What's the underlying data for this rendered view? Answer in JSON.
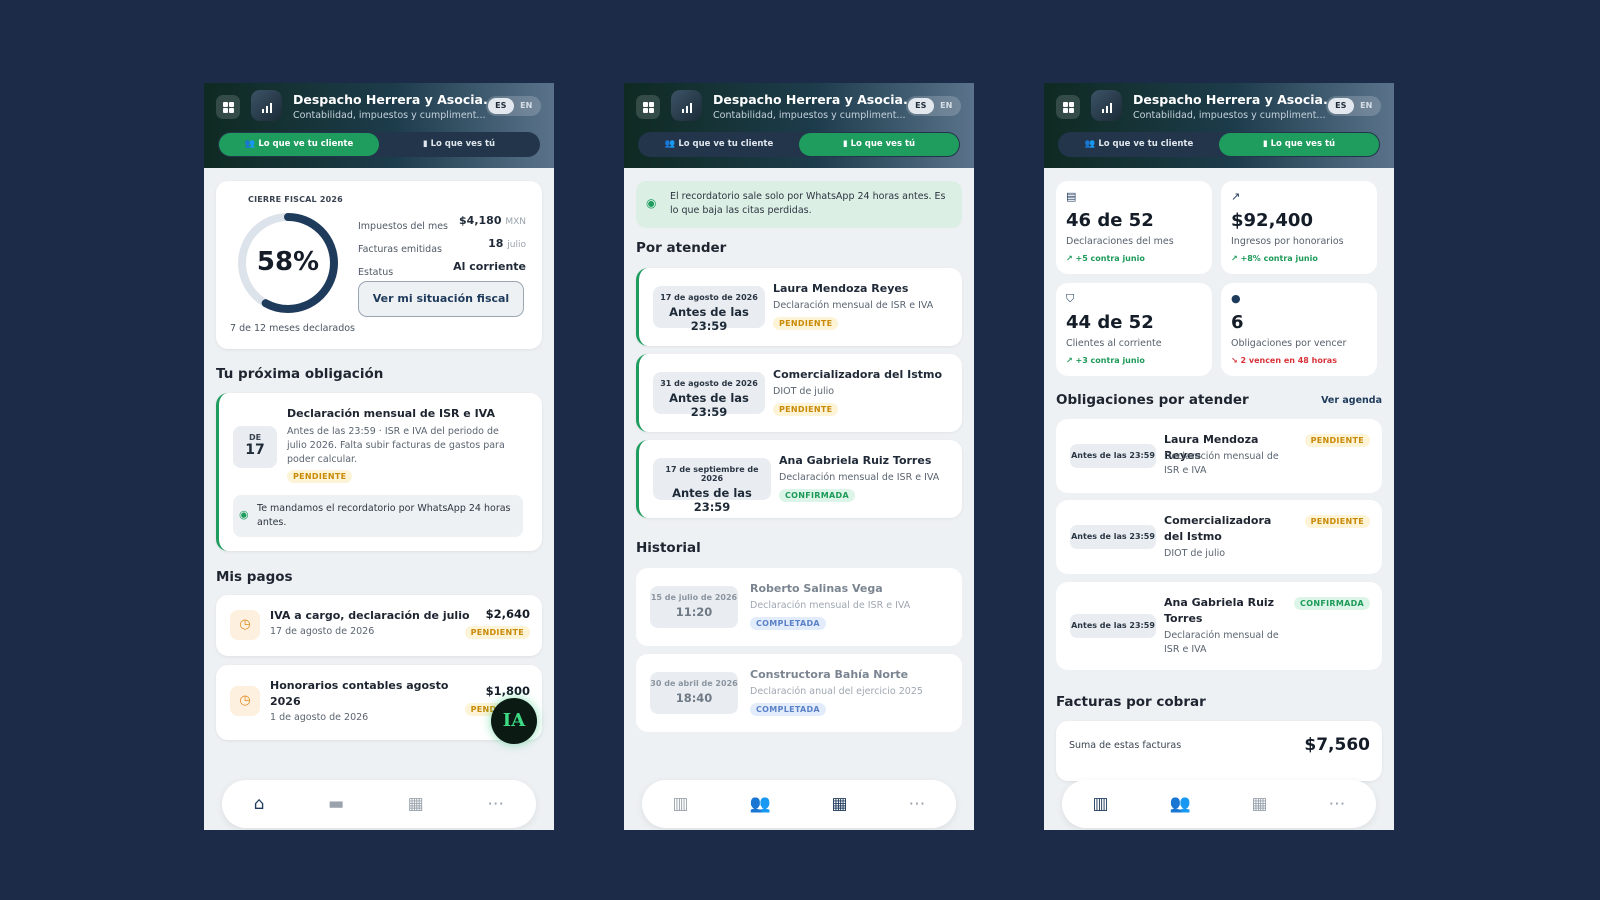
{
  "app": {
    "firm_name": "Despacho Herrera y Asocia...",
    "subtitle": "Contabilidad, impuestos y cumpliment...",
    "lang_es": "ES",
    "lang_en": "EN",
    "tab_client": "Lo que ve tu cliente",
    "tab_you": "Lo que ves tú"
  },
  "screen1": {
    "fiscal_label": "CIERRE FISCAL 2026",
    "percent": "58%",
    "progress": 0.58,
    "months": "7 de 12 meses declarados",
    "rows": [
      {
        "label": "Impuestos del mes",
        "value": "$4,180",
        "unit": "MXN"
      },
      {
        "label": "Facturas emitidas",
        "value": "18",
        "unit": "julio"
      },
      {
        "label": "Estatus",
        "value": "Al corriente",
        "unit": ""
      }
    ],
    "fiscal_button": "Ver mi situación fiscal",
    "next_title": "Tu próxima obligación",
    "ob_day_label": "DE",
    "ob_day": "17",
    "ob_title": "Declaración mensual de ISR e IVA",
    "ob_desc": "Antes de las 23:59 · ISR e IVA del periodo de julio 2026. Falta subir facturas de gastos para poder calcular.",
    "ob_badge": "PENDIENTE",
    "whatsapp_note": "Te mandamos el recordatorio por WhatsApp 24 horas antes.",
    "payments_title": "Mis pagos",
    "payments": [
      {
        "title": "IVA a cargo, declaración de julio",
        "date": "17 de agosto de 2026",
        "amount": "$2,640",
        "badge": "PENDIENTE"
      },
      {
        "title": "Honorarios contables agosto 2026",
        "date": "1 de agosto de 2026",
        "amount": "$1,800",
        "badge": "PENDIENTE"
      }
    ],
    "ai_label": "IA"
  },
  "screen2": {
    "banner": "El recordatorio sale solo por WhatsApp 24 horas antes. Es lo que baja las citas perdidas.",
    "attend_title": "Por atender",
    "appointments": [
      {
        "date": "17 de agosto de 2026",
        "time": "Antes de las 23:59",
        "name": "Laura Mendoza Reyes",
        "desc": "Declaración mensual de ISR e IVA",
        "badge": "PENDIENTE"
      },
      {
        "date": "31 de agosto de 2026",
        "time": "Antes de las 23:59",
        "name": "Comercializadora del Istmo",
        "desc": "DIOT de julio",
        "badge": "PENDIENTE"
      },
      {
        "date": "17 de septiembre de 2026",
        "time": "Antes de las 23:59",
        "name": "Ana Gabriela Ruiz Torres",
        "desc": "Declaración mensual de ISR e IVA",
        "badge": "CONFIRMADA"
      }
    ],
    "history_title": "Historial",
    "history": [
      {
        "date": "15 de julio de 2026",
        "time": "11:20",
        "name": "Roberto Salinas Vega",
        "desc": "Declaración mensual de ISR e IVA",
        "badge": "COMPLETADA"
      },
      {
        "date": "30 de abril de 2026",
        "time": "18:40",
        "name": "Constructora Bahía Norte",
        "desc": "Declaración anual del ejercicio 2025",
        "badge": "COMPLETADA"
      }
    ]
  },
  "screen3": {
    "kpis": [
      {
        "value": "46 de 52",
        "label": "Declaraciones del mes",
        "trend": "+5 contra junio"
      },
      {
        "value": "$92,400",
        "label": "Ingresos por honorarios",
        "trend": "+8% contra junio"
      },
      {
        "value": "44 de 52",
        "label": "Clientes al corriente",
        "trend": "+3 contra junio"
      },
      {
        "value": "6",
        "label": "Obligaciones por vencer",
        "trend": "2 vencen en 48 horas"
      }
    ],
    "obligations_title": "Obligaciones por atender",
    "agenda_link": "Ver agenda",
    "obligations": [
      {
        "chip": "Antes de las 23:59",
        "name": "Laura Mendoza Reyes",
        "desc": "Declaración mensual de ISR e IVA",
        "badge": "PENDIENTE"
      },
      {
        "chip": "Antes de las 23:59",
        "name": "Comercializadora del Istmo",
        "desc": "DIOT de julio",
        "badge": "PENDIENTE"
      },
      {
        "chip": "Antes de las 23:59",
        "name": "Ana Gabriela Ruiz Torres",
        "desc": "Declaración mensual de ISR e IVA",
        "badge": "CONFIRMADA"
      }
    ],
    "invoices_title": "Facturas por cobrar",
    "invoices_sum_label": "Suma de estas facturas",
    "invoices_sum": "$7,560"
  },
  "icons": {
    "home": "home-icon",
    "folder": "folder-icon",
    "calendar": "calendar-icon",
    "more": "more-icon",
    "chart": "chart-icon",
    "users": "users-icon"
  },
  "colors": {
    "accent": "#1f9d5f",
    "pending": "#c98a06",
    "confirmed": "#1d9a58",
    "completed": "#5b82c8",
    "navy": "#1f3b5c",
    "background": "#1c2b47"
  }
}
